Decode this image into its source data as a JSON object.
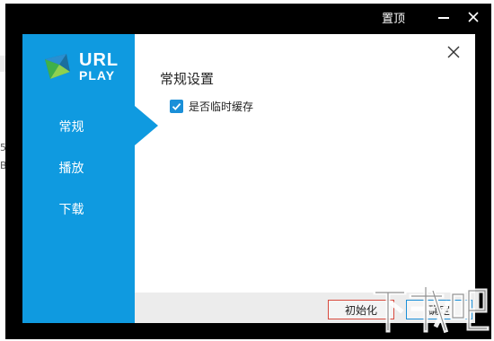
{
  "background": {
    "glyphs": [
      "5",
      "B"
    ]
  },
  "window": {
    "pin_label": "置顶",
    "icons": {
      "minimize": "minimize-icon",
      "close": "close-icon"
    }
  },
  "dialog": {
    "logo": {
      "line1": "URL",
      "line2": "PLAY"
    },
    "nav": {
      "general": "常规",
      "playback": "播放",
      "download": "下载"
    },
    "active_tab": "常规",
    "section_title": "常规设置",
    "cache_option": {
      "label": "是否临时缓存",
      "checked": true
    },
    "buttons": {
      "reset": "初始化",
      "ok": "确定"
    },
    "watermark": "下载吧"
  },
  "colors": {
    "sidebar": "#0f9ae0",
    "checkbox": "#1a8fd8",
    "reset_border": "#d84a3e",
    "ok_border": "#1a8fd8"
  }
}
